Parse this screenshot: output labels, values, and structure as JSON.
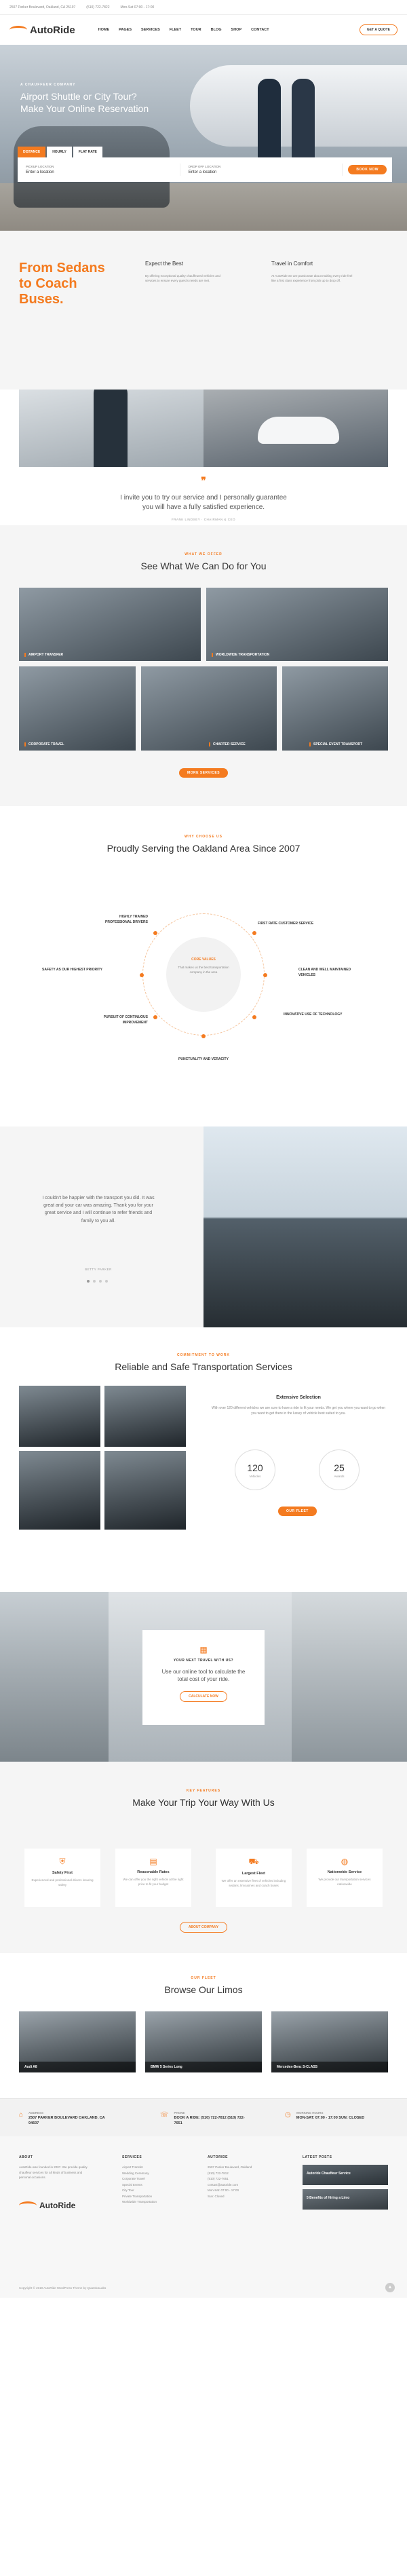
{
  "topbar": {
    "address": "2507 Parker Boulevard, Oakland, CA 25197",
    "phone": "(510) 722-7822",
    "hours": "Mon-Sat 07:00 - 17:00"
  },
  "brand": {
    "name": "AutoRide",
    "accent": "#f47b20"
  },
  "nav": {
    "items": [
      "HOME",
      "PAGES",
      "SERVICES",
      "FLEET",
      "TOUR",
      "BLOG",
      "SHOP",
      "CONTACT"
    ],
    "cta": "GET A QUOTE"
  },
  "hero": {
    "pre": "A CHAUFFEUR COMPANY",
    "title_lines": [
      "Airport Shuttle or City Tour?",
      "Make Your Online Reservation"
    ],
    "tabs": [
      "DISTANCE",
      "HOURLY",
      "FLAT RATE"
    ],
    "fields": [
      {
        "label": "PICKUP LOCATION",
        "value": "Enter a location"
      },
      {
        "label": "DROP OFF LOCATION",
        "value": "Enter a location"
      }
    ],
    "button": "BOOK NOW"
  },
  "intro": {
    "headline": [
      "From Sedans",
      "to Coach",
      "Buses."
    ],
    "cols": [
      {
        "title": "Expect the Best",
        "text": "By offering exceptional quality chauffeured vehicles and services to ensure every guest's needs are met."
      },
      {
        "title": "Travel in Comfort",
        "text": "At AutoRide we are passionate about making every ride feel like a first class experience from pick up to drop off."
      }
    ]
  },
  "testimonial": {
    "quote": "I invite you to try our service and I personally guarantee you will have a fully satisfied experience.",
    "author": "FRANK LINDSEY · CHAIRMAN & CEO"
  },
  "services": {
    "eyebrow": "WHAT WE OFFER",
    "title": "See What We Can Do for You",
    "tiles": [
      "AIRPORT TRANSFER",
      "WORLDWIDE TRANSPORTATION",
      "CORPORATE TRAVEL",
      "CHARTER SERVICE",
      "SPECIAL EVENT TRANSPORT"
    ],
    "button": "MORE SERVICES"
  },
  "oakland": {
    "eyebrow": "WHY CHOOSE US",
    "title": "Proudly Serving the Oakland Area Since 2007",
    "core_title": "CORE VALUES",
    "core_text": "That makes us the best transportation company in the area",
    "features": [
      "HIGHLY TRAINED PROFESSIONAL DRIVERS",
      "FIRST RATE CUSTOMER SERVICE",
      "SAFETY AS OUR HIGHEST PRIORITY",
      "CLEAN AND WELL MAINTAINED VEHICLES",
      "PURSUIT OF CONTINUOUS IMPROVEMENT",
      "INNOVATIVE USE OF TECHNOLOGY",
      "PUNCTUALITY AND VERACITY"
    ]
  },
  "testimonial2": {
    "quote": "I couldn't be happier with the transport you did. It was great and your car was amazing. Thank you for your great service and I will continue to refer friends and family to you all.",
    "author": "BETTY PARKER"
  },
  "reliable": {
    "eyebrow": "COMMITMENT TO WORK",
    "title": "Reliable and Safe Transportation Services",
    "sub": "Extensive Selection",
    "text": "With over 120 different vehicles we are sure to have a ride to fit your needs. We get you where you want to go when you want to get there in the luxury of vehicle best suited to you.",
    "stats": [
      {
        "n": "120",
        "l": "Vehicles"
      },
      {
        "n": "25",
        "l": "Awards"
      }
    ],
    "button": "OUR FLEET"
  },
  "cta": {
    "pre": "YOUR NEXT TRAVEL WITH US?",
    "text": "Use our online tool to calculate the total cost of your ride.",
    "button": "CALCULATE NOW"
  },
  "keyf": {
    "eyebrow": "KEY FEATURES",
    "title": "Make Your Trip Your Way With Us",
    "cards": [
      {
        "t": "Safety First",
        "p": "Experienced and professional drivers insuring safety"
      },
      {
        "t": "Reasonable Rates",
        "p": "We can offer you the right vehicle at the right price to fit your budget"
      },
      {
        "t": "Largest Fleet",
        "p": "We offer an extensive fleet of vehicles including sedans, limousines and coach buses"
      },
      {
        "t": "Nationwide Service",
        "p": "We provide our transportation services nationwide"
      }
    ],
    "button": "ABOUT COMPANY"
  },
  "fleet": {
    "eyebrow": "OUR FLEET",
    "title": "Browse Our Limos",
    "cars": [
      "Audi A8",
      "BMW 5 Series Long",
      "Mercedes-Benz S-CLASS"
    ]
  },
  "contact": [
    {
      "l": "ADDRESS",
      "v": "2507 PARKER BOULEVARD OAKLAND, CA 94607"
    },
    {
      "l": "PHONE",
      "v": "BOOK A RIDE: (510) 722-7812 (510) 722-7651"
    },
    {
      "l": "WORKING HOURS",
      "v": "MON-SAT: 07:00 - 17:00 SUN: CLOSED"
    }
  ],
  "footer": {
    "about_title": "ABOUT",
    "about_text": "AutoRide was founded in 2007. We provide quality chauffeur services for all kinds of business and personal occasions.",
    "services_title": "SERVICES",
    "services": [
      "Airport Transfer",
      "Wedding Ceremony",
      "Corporate Travel",
      "Special Events",
      "City Tour",
      "Private Transportation",
      "Worldwide Transportation"
    ],
    "company_title": "AUTORIDE",
    "company": [
      "2507 Parker Boulevard, Oakland",
      "(510) 722-7812",
      "(510) 722-7651",
      "contact@autoride.com",
      "Mon-Sat: 07:00 - 17:00",
      "Sun: Closed"
    ],
    "posts_title": "LATEST POSTS",
    "posts": [
      "Autoride Chauffeur Service",
      "5 Benefits of Hiring a Limo"
    ],
    "copyright": "Copyright © 2019 AutoRide WordPress Theme by QuanticaLabs"
  }
}
